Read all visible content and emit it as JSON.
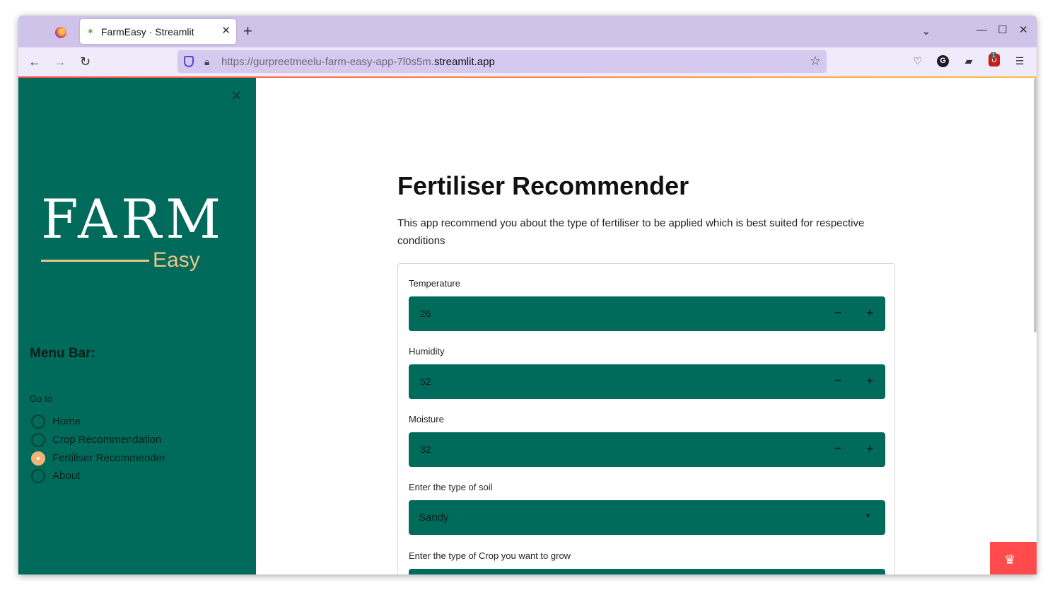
{
  "browser": {
    "tab_title": "FarmEasy · Streamlit",
    "tab_icon": "✶",
    "url_prefix": "https://gurpreetmeelu-farm-easy-app-7l0s5m.",
    "url_domain": "streamlit.app",
    "extension_badge": "1",
    "g_icon_letter": "G"
  },
  "sidebar": {
    "logo_farm": "FARM",
    "logo_easy": "Easy",
    "menu_title": "Menu Bar:",
    "goto_label": "Go to",
    "items": [
      {
        "label": "Home",
        "selected": false
      },
      {
        "label": "Crop Recommendation",
        "selected": false
      },
      {
        "label": "Fertiliser Recommender",
        "selected": true
      },
      {
        "label": "About",
        "selected": false
      }
    ]
  },
  "main": {
    "title": "Fertiliser Recommender",
    "description": "This app recommend you about the type of fertiliser to be applied which is best suited for respective conditions",
    "fields": {
      "temperature": {
        "label": "Temperature",
        "value": "26"
      },
      "humidity": {
        "label": "Humidity",
        "value": "52"
      },
      "moisture": {
        "label": "Moisture",
        "value": "32"
      },
      "soil": {
        "label": "Enter the type of soil",
        "value": "Sandy"
      },
      "crop": {
        "label": "Enter the type of Crop you want to grow"
      }
    },
    "step_minus": "−",
    "step_plus": "+"
  },
  "colors": {
    "sidebar_bg": "#006b5a",
    "input_bg": "#006b5a",
    "accent": "#ff4b4b",
    "radio_selected": "#f5b27a",
    "logo_gold": "#e9c48a"
  }
}
